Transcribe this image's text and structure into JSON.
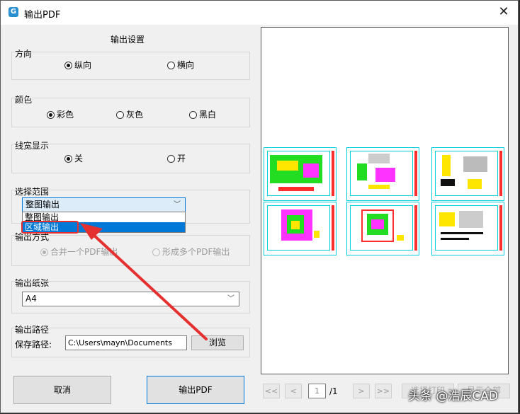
{
  "window": {
    "title": "输出PDF",
    "close": "✕",
    "icon": "G"
  },
  "settings": {
    "heading": "输出设置",
    "orientation": {
      "label": "方向",
      "options": [
        "纵向",
        "横向"
      ],
      "selected": "纵向"
    },
    "color": {
      "label": "颜色",
      "options": [
        "彩色",
        "灰色",
        "黑白"
      ],
      "selected": "彩色"
    },
    "lineweight": {
      "label": "线宽显示",
      "options": [
        "关",
        "开"
      ],
      "selected": "关"
    },
    "range": {
      "label": "选择范围",
      "value": "整图输出",
      "dropdown_options": [
        "整图输出",
        "区域输出"
      ],
      "highlighted": "区域输出"
    },
    "output_mode": {
      "label": "输出方式",
      "options": [
        "合并一个PDF输出",
        "形成多个PDF输出"
      ],
      "selected": "合并一个PDF输出"
    },
    "paper": {
      "label": "输出纸张",
      "value": "A4"
    },
    "path": {
      "label": "输出路径",
      "save_label": "保存路径:",
      "value": "C:\\Users\\mayn\\Documents",
      "browse": "浏览"
    }
  },
  "buttons": {
    "cancel": "取消",
    "export": "输出PDF"
  },
  "pager": {
    "first": "<<",
    "prev": "<",
    "page": "1",
    "total": "/1",
    "next": ">",
    "last": ">>",
    "right1": "选择打印",
    "right2": "显示全部"
  },
  "watermark": "头条 @浩辰CAD",
  "colors": {
    "accent": "#0078d7",
    "annotation": "#e53030",
    "sheet_border": "#00cfe0"
  }
}
